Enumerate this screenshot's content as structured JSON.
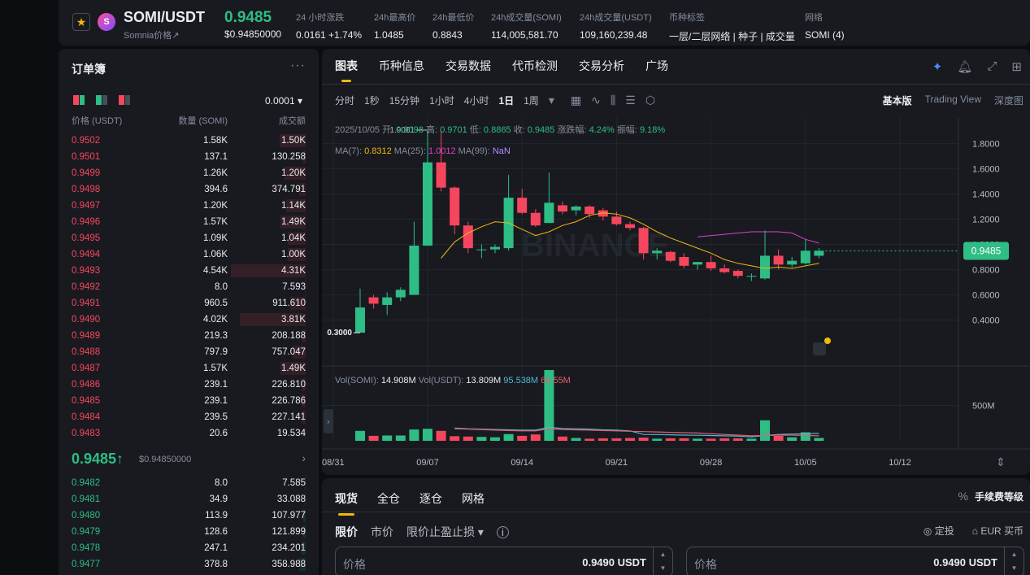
{
  "header": {
    "pair": "SOMI/USDT",
    "subtitle": "Somnia价格↗",
    "price": "0.9485",
    "price_usd": "$0.94850000",
    "stats": [
      {
        "label": "24 小时涨跌",
        "value": "0.0161 +1.74%",
        "color": "#2ebd85"
      },
      {
        "label": "24h最高价",
        "value": "1.0485"
      },
      {
        "label": "24h最低价",
        "value": "0.8843"
      },
      {
        "label": "24h成交量(SOMI)",
        "value": "114,005,581.70"
      },
      {
        "label": "24h成交量(USDT)",
        "value": "109,160,239.48"
      },
      {
        "label": "币种标签",
        "value": "一层/二层网络 | 种子 | 成交量",
        "color": "#f0b90b"
      },
      {
        "label": "网络",
        "value": "SOMI (4)"
      }
    ]
  },
  "orderbook": {
    "title": "订单簿",
    "more_icon": "ellipsis-icon",
    "tick": "0.0001 ▾",
    "col_price": "价格 (USDT)",
    "col_qty": "数量 (SOMI)",
    "col_total": "成交额",
    "asks": [
      {
        "p": "0.9502",
        "q": "1.58K",
        "t": "1.50K",
        "d": 0.24
      },
      {
        "p": "0.9501",
        "q": "137.1",
        "t": "130.258",
        "d": 0.02
      },
      {
        "p": "0.9499",
        "q": "1.26K",
        "t": "1.20K",
        "d": 0.19
      },
      {
        "p": "0.9498",
        "q": "394.6",
        "t": "374.791",
        "d": 0.06
      },
      {
        "p": "0.9497",
        "q": "1.20K",
        "t": "1.14K",
        "d": 0.18
      },
      {
        "p": "0.9496",
        "q": "1.57K",
        "t": "1.49K",
        "d": 0.23
      },
      {
        "p": "0.9495",
        "q": "1.09K",
        "t": "1.04K",
        "d": 0.16
      },
      {
        "p": "0.9494",
        "q": "1.06K",
        "t": "1.00K",
        "d": 0.16
      },
      {
        "p": "0.9493",
        "q": "4.54K",
        "t": "4.31K",
        "d": 0.68
      },
      {
        "p": "0.9492",
        "q": "8.0",
        "t": "7.593",
        "d": 0.01
      },
      {
        "p": "0.9491",
        "q": "960.5",
        "t": "911.610",
        "d": 0.14
      },
      {
        "p": "0.9490",
        "q": "4.02K",
        "t": "3.81K",
        "d": 0.6
      },
      {
        "p": "0.9489",
        "q": "219.3",
        "t": "208.188",
        "d": 0.03
      },
      {
        "p": "0.9488",
        "q": "797.9",
        "t": "757.047",
        "d": 0.12
      },
      {
        "p": "0.9487",
        "q": "1.57K",
        "t": "1.49K",
        "d": 0.23
      },
      {
        "p": "0.9486",
        "q": "239.1",
        "t": "226.810",
        "d": 0.04
      },
      {
        "p": "0.9485",
        "q": "239.1",
        "t": "226.786",
        "d": 0.04
      },
      {
        "p": "0.9484",
        "q": "239.5",
        "t": "227.141",
        "d": 0.04
      },
      {
        "p": "0.9483",
        "q": "20.6",
        "t": "19.534",
        "d": 0.01
      }
    ],
    "mid_price": "0.9485↑",
    "mid_usd": "$0.94850000",
    "bids": [
      {
        "p": "0.9482",
        "q": "8.0",
        "t": "7.585",
        "d": 0.01
      },
      {
        "p": "0.9481",
        "q": "34.9",
        "t": "33.088",
        "d": 0.01
      },
      {
        "p": "0.9480",
        "q": "113.9",
        "t": "107.977",
        "d": 0.02
      },
      {
        "p": "0.9479",
        "q": "128.6",
        "t": "121.899",
        "d": 0.02
      },
      {
        "p": "0.9478",
        "q": "247.1",
        "t": "234.201",
        "d": 0.04
      },
      {
        "p": "0.9477",
        "q": "378.8",
        "t": "358.988",
        "d": 0.06
      }
    ]
  },
  "chart_panel": {
    "tabs": [
      "图表",
      "币种信息",
      "交易数据",
      "代币检测",
      "交易分析",
      "广场"
    ],
    "tool_icons": [
      "sparkle-icon",
      "bell-icon",
      "expand-icon",
      "layout-icon"
    ],
    "timeframes": [
      "分时",
      "1秒",
      "15分钟",
      "1小时",
      "4小时",
      "1日",
      "1周"
    ],
    "active_timeframe": "1日",
    "view_modes": [
      "基本版",
      "Trading View",
      "深度图"
    ],
    "active_view": "基本版"
  },
  "chart_data": {
    "type": "candlestick",
    "title": "",
    "info": {
      "date": "2025/10/05",
      "open_label": "开:",
      "open": "0.9098",
      "high_label": "高:",
      "high": "0.9701",
      "low_label": "低:",
      "low": "0.8865",
      "close_label": "收:",
      "close": "0.9485",
      "change_label": "涨跌幅:",
      "change": "4.24%",
      "amp_label": "振幅:",
      "amp": "9.18%"
    },
    "ma_legend": [
      {
        "label": "MA(7):",
        "value": "0.8312",
        "color": "#f0b90b"
      },
      {
        "label": "MA(25):",
        "value": "1.0012",
        "color": "#e040c8"
      },
      {
        "label": "MA(99):",
        "value": "NaN",
        "color": "#b48cff"
      }
    ],
    "vol_legend": [
      {
        "label": "Vol(SOMI):",
        "value": "14.908M",
        "color": "#eaecef"
      },
      {
        "label": "Vol(USDT):",
        "value": "13.809M",
        "color": "#eaecef"
      },
      {
        "label": "",
        "value": "95.538M",
        "color": "#4fb9d6"
      },
      {
        "label": "",
        "value": "66.55M",
        "color": "#e0606e"
      }
    ],
    "y_ticks": [
      0.4,
      0.6,
      0.8,
      1.0,
      1.2,
      1.4,
      1.6,
      1.8
    ],
    "y_tick_labels": [
      "0.4000",
      "0.6000",
      "0.8000",
      "1.0000",
      "1.2000",
      "1.4000",
      "1.6000",
      "1.8000"
    ],
    "ylim": [
      0.12,
      1.97
    ],
    "x_labels": [
      {
        "label": "08/31",
        "index": -2
      },
      {
        "label": "09/07",
        "index": 5
      },
      {
        "label": "09/14",
        "index": 12
      },
      {
        "label": "09/21",
        "index": 19
      },
      {
        "label": "09/28",
        "index": 26
      },
      {
        "label": "10/05",
        "index": 33
      },
      {
        "label": "10/12",
        "index": 40
      }
    ],
    "current_price_label": "0.9485",
    "high_marker": "1.9061",
    "low_marker": "0.3000",
    "vol_tick": "500M",
    "vol_tick_value": 500,
    "vol_max": 1000,
    "candles": [
      {
        "o": 0.3,
        "h": 0.65,
        "l": 0.3,
        "c": 0.5,
        "v": 140
      },
      {
        "o": 0.58,
        "h": 0.6,
        "l": 0.49,
        "c": 0.53,
        "v": 70
      },
      {
        "o": 0.52,
        "h": 0.62,
        "l": 0.44,
        "c": 0.58,
        "v": 75
      },
      {
        "o": 0.58,
        "h": 0.66,
        "l": 0.55,
        "c": 0.64,
        "v": 75
      },
      {
        "o": 0.6,
        "h": 1.18,
        "l": 0.6,
        "c": 0.99,
        "v": 160
      },
      {
        "o": 0.99,
        "h": 1.9,
        "l": 0.99,
        "c": 1.65,
        "v": 170
      },
      {
        "o": 1.65,
        "h": 1.9,
        "l": 1.42,
        "c": 1.45,
        "v": 140
      },
      {
        "o": 1.45,
        "h": 1.46,
        "l": 1.08,
        "c": 1.15,
        "v": 65
      },
      {
        "o": 1.15,
        "h": 1.18,
        "l": 0.93,
        "c": 0.97,
        "v": 60
      },
      {
        "o": 0.96,
        "h": 1.0,
        "l": 0.89,
        "c": 0.96,
        "v": 55
      },
      {
        "o": 0.96,
        "h": 1.0,
        "l": 0.93,
        "c": 0.98,
        "v": 50
      },
      {
        "o": 0.97,
        "h": 1.55,
        "l": 0.95,
        "c": 1.37,
        "v": 95
      },
      {
        "o": 1.37,
        "h": 1.44,
        "l": 1.24,
        "c": 1.25,
        "v": 70
      },
      {
        "o": 1.25,
        "h": 1.28,
        "l": 1.14,
        "c": 1.15,
        "v": 90
      },
      {
        "o": 1.17,
        "h": 1.57,
        "l": 1.17,
        "c": 1.33,
        "v": 1000
      },
      {
        "o": 1.31,
        "h": 1.34,
        "l": 1.24,
        "c": 1.26,
        "v": 60
      },
      {
        "o": 1.27,
        "h": 1.31,
        "l": 1.23,
        "c": 1.3,
        "v": 40
      },
      {
        "o": 1.3,
        "h": 1.31,
        "l": 1.21,
        "c": 1.24,
        "v": 30
      },
      {
        "o": 1.27,
        "h": 1.29,
        "l": 1.19,
        "c": 1.22,
        "v": 35
      },
      {
        "o": 1.22,
        "h": 1.26,
        "l": 1.15,
        "c": 1.16,
        "v": 35
      },
      {
        "o": 1.16,
        "h": 1.18,
        "l": 1.11,
        "c": 1.13,
        "v": 40
      },
      {
        "o": 1.13,
        "h": 1.14,
        "l": 0.88,
        "c": 0.93,
        "v": 45
      },
      {
        "o": 0.93,
        "h": 0.97,
        "l": 0.88,
        "c": 0.95,
        "v": 30
      },
      {
        "o": 0.94,
        "h": 0.95,
        "l": 0.86,
        "c": 0.87,
        "v": 35
      },
      {
        "o": 0.9,
        "h": 0.93,
        "l": 0.81,
        "c": 0.83,
        "v": 35
      },
      {
        "o": 0.84,
        "h": 0.86,
        "l": 0.8,
        "c": 0.86,
        "v": 30
      },
      {
        "o": 0.86,
        "h": 0.91,
        "l": 0.79,
        "c": 0.81,
        "v": 30
      },
      {
        "o": 0.81,
        "h": 0.84,
        "l": 0.77,
        "c": 0.78,
        "v": 35
      },
      {
        "o": 0.79,
        "h": 0.8,
        "l": 0.73,
        "c": 0.75,
        "v": 35
      },
      {
        "o": 0.75,
        "h": 0.77,
        "l": 0.71,
        "c": 0.75,
        "v": 30
      },
      {
        "o": 0.73,
        "h": 1.11,
        "l": 0.72,
        "c": 0.91,
        "v": 290
      },
      {
        "o": 0.91,
        "h": 0.96,
        "l": 0.8,
        "c": 0.84,
        "v": 70
      },
      {
        "o": 0.84,
        "h": 0.9,
        "l": 0.82,
        "c": 0.87,
        "v": 50
      },
      {
        "o": 0.85,
        "h": 1.04,
        "l": 0.84,
        "c": 0.95,
        "v": 120
      },
      {
        "o": 0.91,
        "h": 0.97,
        "l": 0.89,
        "c": 0.95,
        "v": 40
      }
    ],
    "ma7": [
      null,
      null,
      null,
      null,
      null,
      null,
      0.89,
      1.02,
      1.09,
      1.14,
      1.18,
      1.17,
      1.12,
      1.07,
      1.1,
      1.15,
      1.18,
      1.23,
      1.25,
      1.24,
      1.21,
      1.16,
      1.1,
      1.05,
      1.01,
      0.97,
      0.93,
      0.88,
      0.85,
      0.83,
      0.81,
      0.82,
      0.81,
      0.83,
      0.85
    ],
    "ma25": [
      null,
      null,
      null,
      null,
      null,
      null,
      null,
      null,
      null,
      null,
      null,
      null,
      null,
      null,
      null,
      null,
      null,
      null,
      null,
      null,
      null,
      null,
      null,
      null,
      null,
      1.06,
      1.07,
      1.08,
      1.09,
      1.1,
      1.1,
      1.1,
      1.09,
      1.04,
      1.01
    ],
    "vol_ma_a": [
      null,
      null,
      null,
      null,
      null,
      null,
      null,
      180,
      170,
      165,
      160,
      155,
      150,
      150,
      190,
      175,
      170,
      165,
      155,
      150,
      140,
      90,
      88,
      85,
      80,
      78,
      75,
      70,
      65,
      55,
      75,
      90,
      95,
      100,
      105
    ],
    "vol_ma_b": [
      null,
      null,
      null,
      null,
      null,
      null,
      null,
      170,
      165,
      160,
      150,
      145,
      140,
      140,
      170,
      160,
      155,
      150,
      145,
      140,
      135,
      130,
      125,
      120,
      115,
      110,
      100,
      90,
      80,
      70,
      75,
      80,
      80,
      75,
      70
    ]
  },
  "trade": {
    "tabs": [
      "现货",
      "全仓",
      "逐仓",
      "网格"
    ],
    "fee_label": "手续费等级",
    "fee_icon": "percent-icon",
    "order_types": [
      "限价",
      "市价",
      "限价止盈止损 ▾"
    ],
    "info_icon": "info-icon",
    "tools": [
      "◎ 定投",
      "⌂ EUR 买币"
    ],
    "buy_price_label": "价格",
    "buy_price": "0.9490  USDT",
    "sell_price_label": "价格",
    "sell_price": "0.9490  USDT"
  }
}
